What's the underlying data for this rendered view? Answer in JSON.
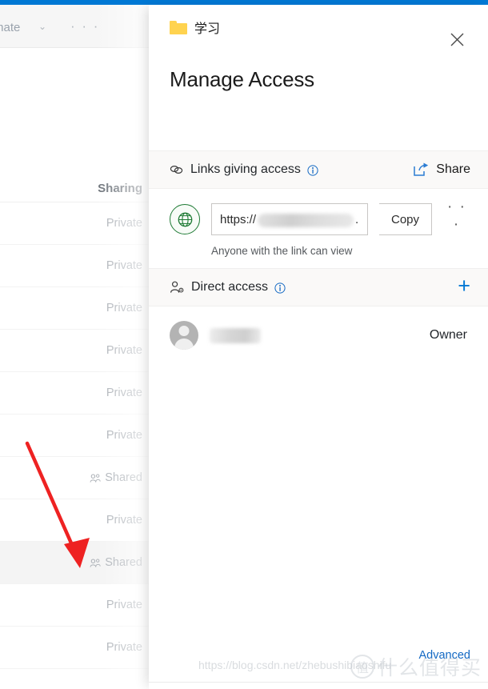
{
  "theme": {
    "accent": "#0078d4",
    "link_blue": "#1268c3",
    "globe_green": "#1e7a34",
    "folder_yellow": "#ffd34f",
    "arrow_red": "#ee2222",
    "section_bg": "#faf9f8"
  },
  "background": {
    "toolbar": {
      "automate_label": "mate",
      "chevron": "⌄",
      "ellipsis": "· · ·"
    },
    "column_header": "Sharing",
    "rows": [
      {
        "label": "Private",
        "shared": false,
        "selected": false
      },
      {
        "label": "Private",
        "shared": false,
        "selected": false
      },
      {
        "label": "Private",
        "shared": false,
        "selected": false
      },
      {
        "label": "Private",
        "shared": false,
        "selected": false
      },
      {
        "label": "Private",
        "shared": false,
        "selected": false
      },
      {
        "label": "Private",
        "shared": false,
        "selected": false
      },
      {
        "label": "Shared",
        "shared": true,
        "selected": false
      },
      {
        "label": "Private",
        "shared": false,
        "selected": false
      },
      {
        "label": "Shared",
        "shared": true,
        "selected": true
      },
      {
        "label": "Private",
        "shared": false,
        "selected": false
      },
      {
        "label": "Private",
        "shared": false,
        "selected": false
      }
    ]
  },
  "panel": {
    "folder_name": "学习",
    "folder_icon": "folder-icon",
    "close_icon": "close-icon",
    "title": "Manage Access",
    "links_section": {
      "icon": "link-chain-icon",
      "label": "Links giving access",
      "info_icon": "info-icon",
      "share_icon": "share-icon",
      "share_label": "Share"
    },
    "link_item": {
      "scope_icon": "globe-icon",
      "url_prefix": "https://",
      "url_redacted": true,
      "url_suffix": ".",
      "copy_label": "Copy",
      "more_ellipsis": "· · ·",
      "caption": "Anyone with the link can view"
    },
    "direct_access_section": {
      "icon": "person-gear-icon",
      "label": "Direct access",
      "info_icon": "info-icon",
      "add_icon": "plus-icon"
    },
    "people": [
      {
        "avatar_icon": "avatar-person-icon",
        "name_redacted": true,
        "role": "Owner"
      }
    ],
    "advanced_label": "Advanced"
  },
  "watermarks": {
    "url": "https://blog.csdn.net/zhebushibiaoshifu",
    "logo_badge": "值",
    "logo_text": "什么值得买"
  }
}
